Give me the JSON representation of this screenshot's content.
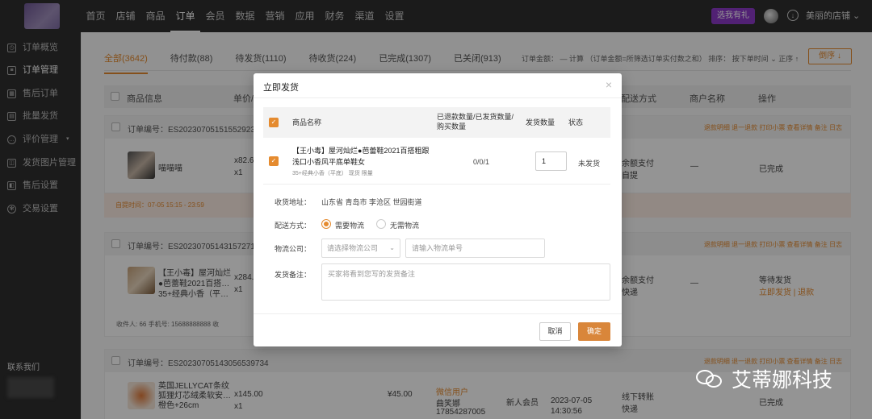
{
  "topbar": {
    "nav": [
      "首页",
      "店铺",
      "商品",
      "订单",
      "会员",
      "数据",
      "营销",
      "应用",
      "财务",
      "渠道",
      "设置"
    ],
    "active_nav": "订单",
    "promo_label": "选我有礼",
    "store_name": "美丽的店铺 ⌄"
  },
  "sidebar": {
    "items": [
      {
        "label": "订单概览",
        "icon": "clock-icon",
        "active": false
      },
      {
        "label": "订单管理",
        "icon": "list-icon",
        "active": true
      },
      {
        "label": "售后订单",
        "icon": "grid-icon",
        "active": false
      },
      {
        "label": "批量发货",
        "icon": "doc-icon",
        "active": false
      },
      {
        "label": "评价管理",
        "icon": "comment-icon",
        "active": false
      },
      {
        "label": "发货图片管理",
        "icon": "image-icon",
        "active": false
      },
      {
        "label": "售后设置",
        "icon": "box-icon",
        "active": false
      },
      {
        "label": "交易设置",
        "icon": "gear-icon",
        "active": false
      }
    ],
    "contact": "联系我们"
  },
  "main": {
    "tabs": [
      "全部(3642)",
      "待付款(88)",
      "待发货(1110)",
      "待收货(224)",
      "已完成(1307)",
      "已关闭(913)"
    ],
    "sort_text": "订单金额： — 计算 （订单金额=所筛选订单实付数之和） 排序： 按下单时间 ⌄    正序 ↑",
    "desc_button": "倒序 ↓",
    "headers": [
      "商品信息",
      "单价/",
      "配送方式",
      "商户名称",
      "操作"
    ],
    "orders": [
      {
        "no": "订单编号：ES2023070515155292​35",
        "links": "退款明细  退一退款  打印小票  查看详情  备注  日志",
        "item": "喵喵喵",
        "price": "x82.6",
        "qty": "x1",
        "ship": "余额支付",
        "ship2": "自提",
        "merchant": "—",
        "status": "已完成"
      },
      {
        "no": "订单编号：ES20230705143157271​1",
        "links": "退款明细  退一退款  打印小票  查看详情  备注  日志",
        "item": "【王小毒】屋河灿烂●芭蕾鞋2021百搭…35+经典小香（平…",
        "price": "x284.",
        "qty": "x1",
        "ship": "余额支付",
        "ship2": "快递",
        "merchant": "—",
        "status": "等待发货",
        "status2": "立即发货 | 退款"
      },
      {
        "no": "订单编号：ES20230705143056539734",
        "links": "退款明细  退一退款  打印小票  查看详情  备注  日志",
        "item": "英国JELLYCAT条纹狐狸灯芯绒柔软安… 橙色+26cm",
        "price": "x145.00",
        "qty": "x1",
        "amount": "¥45.00",
        "buyer": "微信用户",
        "buyer_name": "曲笑娜",
        "buyer_phone": "17854287005",
        "member": "新人会员",
        "time": "2023-07-05 14:30:56",
        "ship": "线下转账",
        "ship2": "快递",
        "status": "已完成"
      }
    ],
    "auto_time": "自提时间：07-05 15:15 - 23:59",
    "receiver": "收件人: 66      手机号: 15688888888      收"
  },
  "modal": {
    "title": "立即发货",
    "col_name": "商品名称",
    "col_refund": "已退款数量/已发货数量/购买数量",
    "col_ship_qty": "发货数量",
    "col_status": "状态",
    "product_name": "【王小毒】屋河灿烂●芭蕾鞋2021百搭粗跟浅口小香风平底单鞋女",
    "product_sku": "35+经典小香（平底） 现货 限量",
    "refund_counts": "0/0/1",
    "ship_qty": "1",
    "status": "未发货",
    "address_label": "收货地址：",
    "address": "山东省 青岛市 李沧区 世园街道",
    "delivery_label": "配送方式：",
    "delivery_options": [
      "需要物流",
      "无需物流"
    ],
    "logistics_label": "物流公司：",
    "logistics_placeholder": "请选择物流公司",
    "tracking_placeholder": "请输入物流单号",
    "remark_label": "发货备注：",
    "remark_placeholder": "买家将看到您写的发货备注",
    "cancel": "取消",
    "confirm": "确定"
  },
  "watermark": "艾蒂娜科技",
  "colors": {
    "accent": "#e58b2f",
    "topbar": "#2f2f2f",
    "promo": "#8c39c9"
  }
}
